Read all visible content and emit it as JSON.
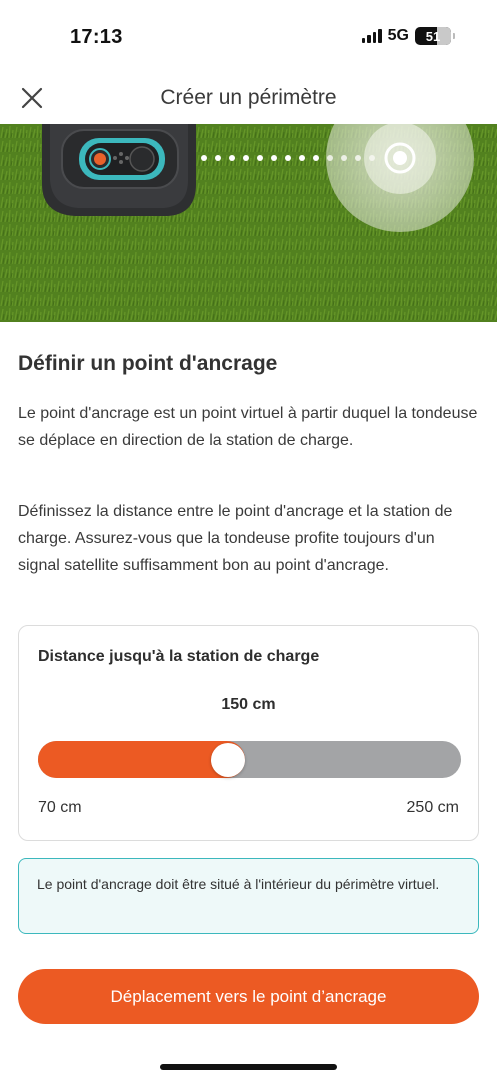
{
  "status_bar": {
    "time": "17:13",
    "network": "5G",
    "battery": "51"
  },
  "header": {
    "title": "Créer un périmètre",
    "close_icon": "close-icon"
  },
  "hero": {
    "illustration": "robot-mower-on-grass",
    "colors": {
      "grass": "#4f7d1e",
      "mower_body": "#2e2f31",
      "mower_accent": "#3cb8bd"
    }
  },
  "content": {
    "section_title": "Définir un point d'ancrage",
    "paragraph1": "Le point d'ancrage est un point virtuel à partir duquel la tondeuse se déplace en direction de la station de charge.",
    "paragraph2": "Définissez la distance entre le point d'ancrage et la station de charge. Assurez-vous que la tondeuse profite toujours d'un signal satellite suffisamment bon au point d'ancrage."
  },
  "distance_card": {
    "title": "Distance jusqu'à la station de charge",
    "value_label": "150 cm",
    "value": 150,
    "min": 70,
    "max": 250,
    "min_label": "70 cm",
    "max_label": "250 cm"
  },
  "info_box": {
    "text": "Le point d'ancrage doit être situé à l'intérieur du périmètre virtuel."
  },
  "cta": {
    "label": "Déplacement vers le point d’ancrage"
  },
  "colors": {
    "accent": "#ec5a23",
    "track": "#a3a4a6",
    "info_border": "#3cb8bd",
    "info_background": "#eef9f9"
  }
}
